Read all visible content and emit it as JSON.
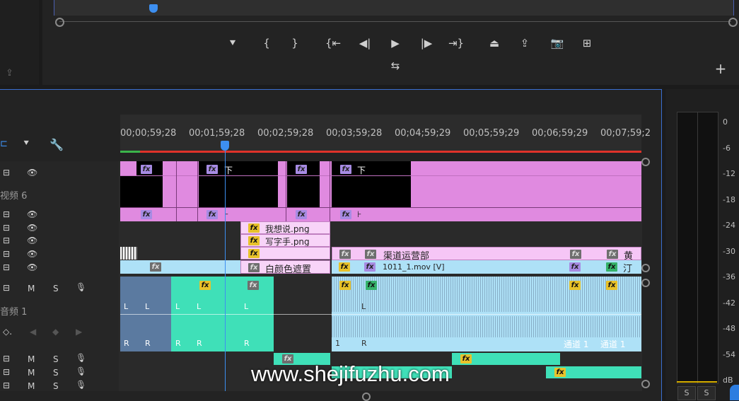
{
  "program_monitor": {
    "controls": [
      {
        "name": "add-marker-button",
        "icon": "marker-icon",
        "glyph": "⯆"
      },
      {
        "name": "mark-in-button",
        "icon": "mark-in-icon",
        "glyph": "{"
      },
      {
        "name": "mark-out-button",
        "icon": "mark-out-icon",
        "glyph": "}"
      },
      {
        "name": "go-to-in-button",
        "icon": "go-to-in-icon",
        "glyph": "{⇤"
      },
      {
        "name": "step-back-button",
        "icon": "step-back-icon",
        "glyph": "◀|"
      },
      {
        "name": "play-button",
        "icon": "play-icon",
        "glyph": "▶"
      },
      {
        "name": "step-forward-button",
        "icon": "step-forward-icon",
        "glyph": "|▶"
      },
      {
        "name": "go-to-out-button",
        "icon": "go-to-out-icon",
        "glyph": "⇥}"
      },
      {
        "name": "lift-button",
        "icon": "lift-icon",
        "glyph": "⏏"
      },
      {
        "name": "extract-button",
        "icon": "extract-icon",
        "glyph": "⇪"
      },
      {
        "name": "export-frame-button",
        "icon": "camera-icon",
        "glyph": "📷"
      },
      {
        "name": "insert-button",
        "icon": "insert-icon",
        "glyph": "⊞"
      }
    ],
    "secondary_control": {
      "name": "comparison-view-button",
      "icon": "compare-icon",
      "glyph": "⇆"
    },
    "add_button_glyph": "+"
  },
  "timeline": {
    "time_labels": [
      "00;00;59;28",
      "00;01;59;28",
      "00;02;59;28",
      "00;03;59;28",
      "00;04;59;29",
      "00;05;59;29",
      "00;06;59;29",
      "00;07;59;2"
    ],
    "track_labels": {
      "video6": "视频 6",
      "audio1": "音频 1"
    },
    "mute_letter": "M",
    "solo_letter": "S",
    "clips": {
      "fx": "fx",
      "title_down": "下",
      "png1": "我想说.png",
      "png2": "写字手.png",
      "mask": "白颜色遮置",
      "channel": "渠道运营部",
      "mov": "1011_1.mov [V]",
      "huang": "黄",
      "ding": "汀",
      "channel1": "通道 1",
      "L": "L",
      "R": "R",
      "one": "1"
    }
  },
  "audio_meter": {
    "scale": [
      "0",
      "-6",
      "-12",
      "-18",
      "-24",
      "-30",
      "-36",
      "-42",
      "-48",
      "-54",
      "dB"
    ],
    "solo_buttons": [
      "S",
      "S"
    ]
  },
  "watermark": "www.shejifuzhu.com",
  "colors": {
    "pink": "#e08ae0",
    "light_pink": "#f4c0f4",
    "light_blue": "#aee1f7",
    "teal": "#3fe0b8",
    "playhead": "#3d8ff0"
  }
}
